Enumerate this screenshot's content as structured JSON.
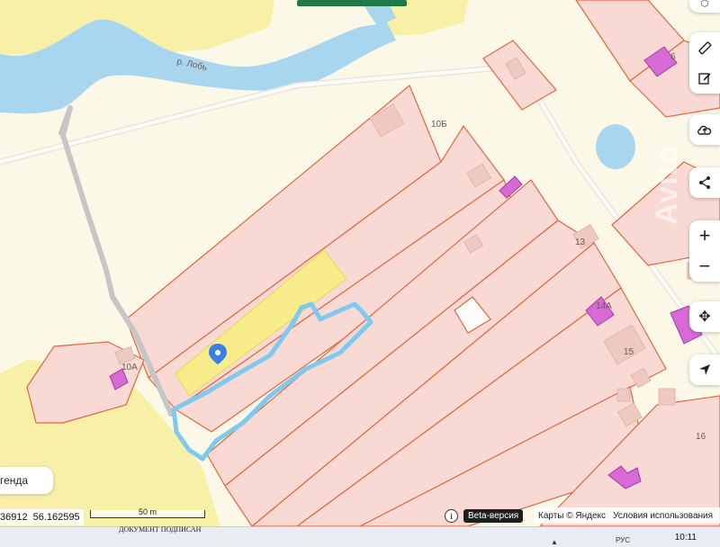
{
  "map": {
    "river_label": "р. Лобь",
    "parcel_numbers": [
      "10Б",
      "10А",
      "13",
      "14А",
      "15",
      "16",
      "6"
    ],
    "colors": {
      "background": "#fbf8e8",
      "water": "#a9d6ef",
      "field": "#f7f0a6",
      "parcel_fill": "#f8d9d3",
      "parcel_border": "#e0683f",
      "building": "#d86ad8",
      "selected_parcel": "#f8ec8a",
      "route": "#7fc8ee",
      "road": "#c6c6c6",
      "marker": "#3a7ee8"
    }
  },
  "left_panel": {
    "legend_label": "генда"
  },
  "coordinates": {
    "lat": "36912",
    "lon": "56.162595"
  },
  "scale": {
    "label": "50 m"
  },
  "footer": {
    "beta_label": "Beta-версия",
    "copyright": "Карты © Яндекс",
    "terms": "Условия использования"
  },
  "sidebar_tools": [
    "ruler-icon",
    "edit-icon",
    "cloud-upload-icon",
    "share-icon",
    "zoom-in-icon",
    "zoom-out-icon",
    "move-icon",
    "locate-icon"
  ],
  "taskbar": {
    "document_text": "ДОКУМЕНТ ПОДПИСАН",
    "tray_text": "РУС",
    "time": "10:11"
  },
  "watermark": "Avito"
}
